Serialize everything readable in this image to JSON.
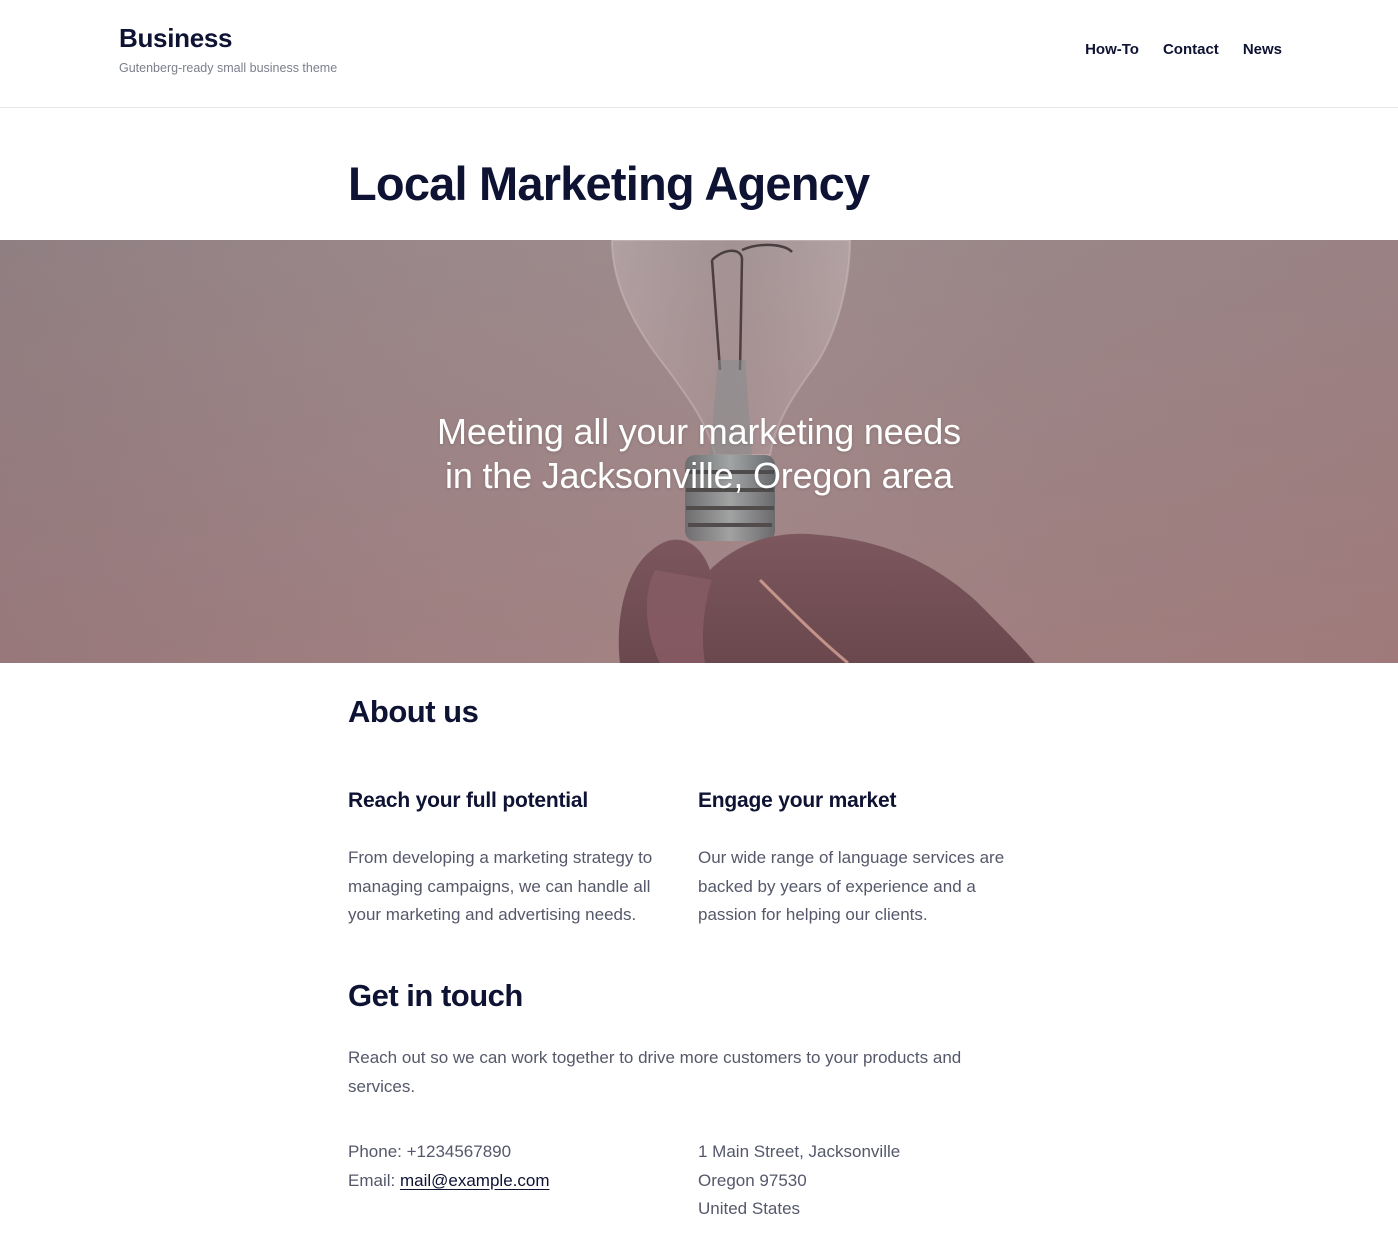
{
  "header": {
    "site_title": "Business",
    "tagline": "Gutenberg-ready small business theme",
    "nav": [
      {
        "label": "How-To"
      },
      {
        "label": "Contact"
      },
      {
        "label": "News"
      }
    ]
  },
  "page": {
    "title": "Local Marketing Agency"
  },
  "hero": {
    "line1": "Meeting all your marketing needs",
    "line2": "in the Jacksonville, Oregon area"
  },
  "about": {
    "heading": "About us",
    "columns": [
      {
        "heading": "Reach your full potential",
        "text": "From developing a marketing strategy to managing campaigns, we can handle all your marketing and advertising needs."
      },
      {
        "heading": "Engage your market",
        "text": "Our wide range of language services are backed by years of experience and a passion for helping our clients."
      }
    ]
  },
  "contact": {
    "heading": "Get in touch",
    "text": "Reach out so we can work together to drive more customers to your products and services.",
    "phone_label": "Phone: +1234567890",
    "email_prefix": "Email: ",
    "email": "mail@example.com",
    "address_line1": "1 Main Street, Jacksonville",
    "address_line2": "Oregon 97530",
    "address_line3": "United States"
  }
}
